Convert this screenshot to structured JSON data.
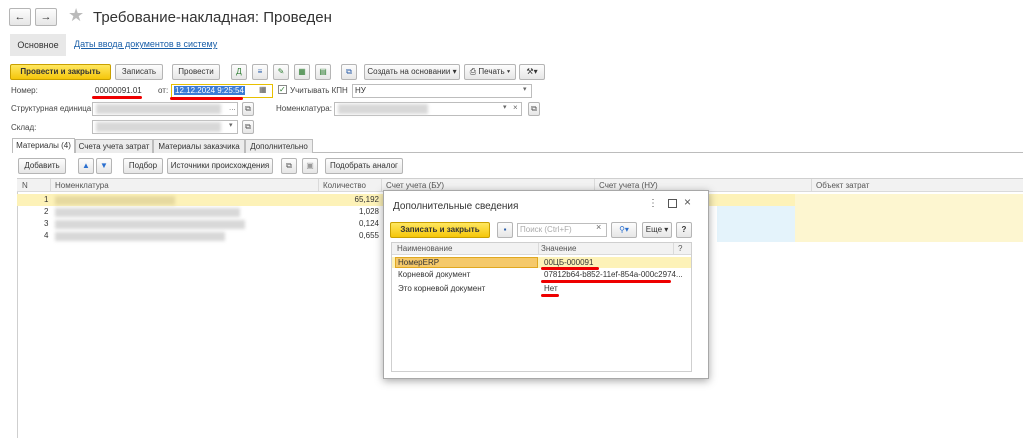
{
  "window": {
    "title": "Требование-накладная: Проведен"
  },
  "nav": {
    "main_tab": "Основное",
    "link": "Даты ввода документов в систему"
  },
  "toolbar": {
    "post_close": "Провести и закрыть",
    "save": "Записать",
    "post": "Провести",
    "create_based": "Создать на основании",
    "print": "Печать"
  },
  "form": {
    "number_label": "Номер:",
    "number_value": "00000091.01",
    "date_label": "от:",
    "date_value": "12.12.2024  9:25:54",
    "kpn_label": "Учитывать КПН",
    "kpn_value": "НУ",
    "unit_label": "Структурная единица:",
    "nomenclature_label": "Номенклатура:",
    "warehouse_label": "Склад:"
  },
  "tabs": [
    "Материалы (4)",
    "Счета учета затрат",
    "Материалы заказчика",
    "Дополнительно"
  ],
  "tab_toolbar": {
    "add": "Добавить",
    "select": "Подбор",
    "sources": "Источники происхождения",
    "pick_analog": "Подобрать аналог"
  },
  "table": {
    "columns": [
      "N",
      "Номенклатура",
      "Количество",
      "Счет учета (БУ)",
      "Счет учета (НУ)",
      "Объект затрат"
    ],
    "rows": [
      {
        "n": "1",
        "qty": "65,192"
      },
      {
        "n": "2",
        "qty": "1,028"
      },
      {
        "n": "3",
        "qty": "0,124"
      },
      {
        "n": "4",
        "qty": "0,655"
      }
    ]
  },
  "dialog": {
    "title": "Дополнительные сведения",
    "save_close": "Записать и закрыть",
    "search_placeholder": "Поиск (Ctrl+F)",
    "more": "Еще",
    "help": "?",
    "columns": [
      "Наименование",
      "Значение",
      "?"
    ],
    "rows": [
      {
        "name": "НомерERP",
        "value": "00ЦБ-000091"
      },
      {
        "name": "Корневой документ",
        "value": "07812b64-b852-11ef-854a-000c2974..."
      },
      {
        "name": "Это корневой документ",
        "value": "Нет"
      }
    ]
  },
  "colors": {
    "accent": "#f5c60a",
    "selection": "#fdf2b8",
    "highlight_red": "#e00000",
    "link": "#1a5fa8"
  }
}
